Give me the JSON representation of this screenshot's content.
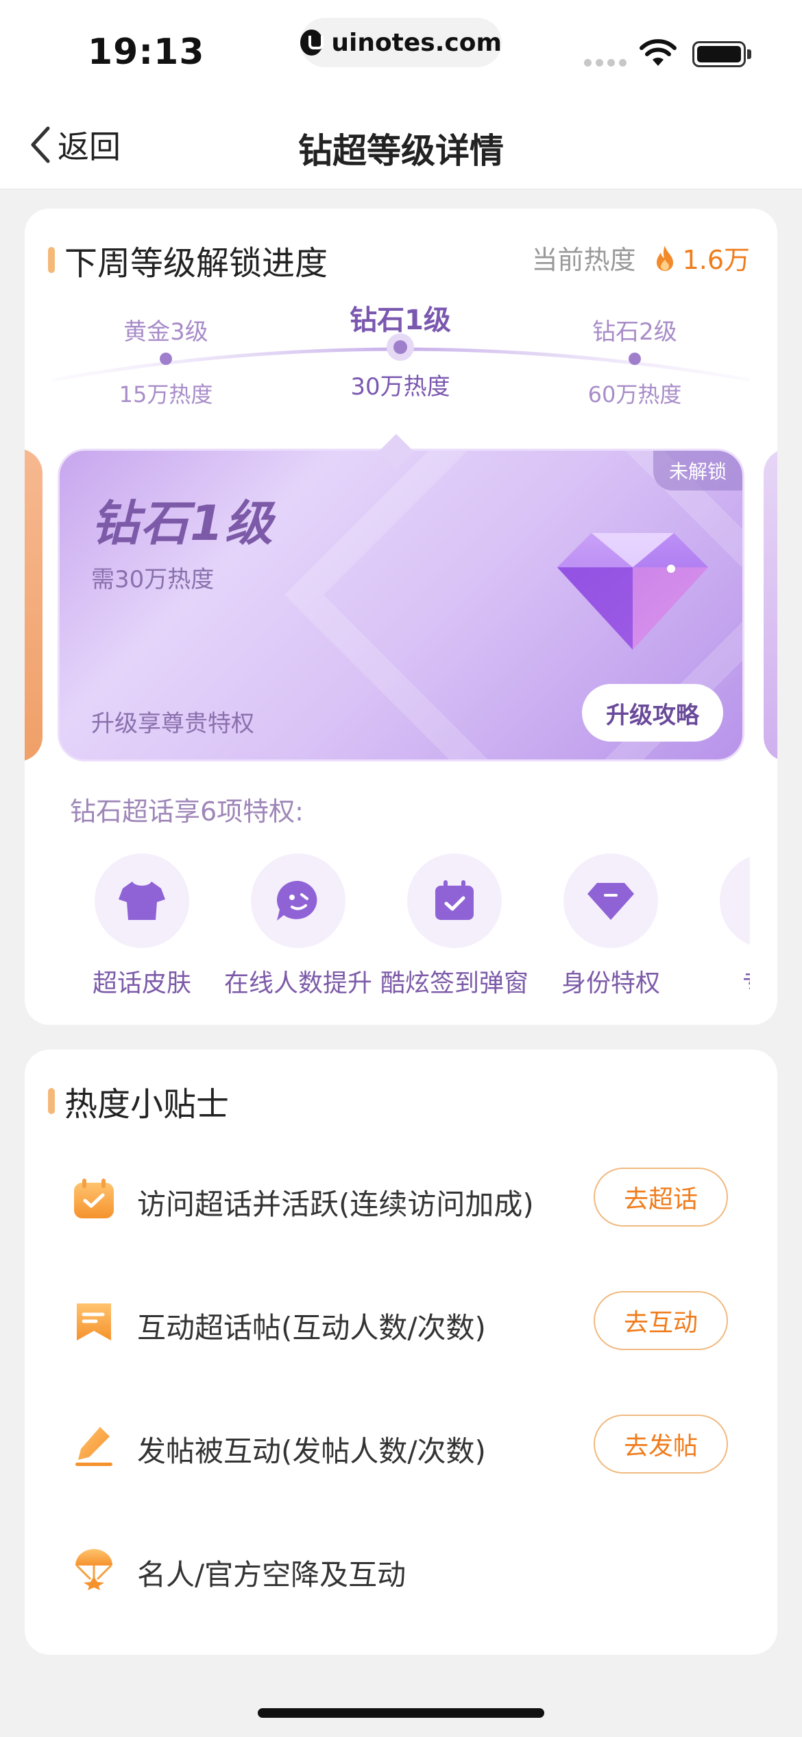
{
  "status_bar": {
    "time": "19:13",
    "url": "uinotes.com",
    "icons": [
      "signal-icon",
      "wifi-icon",
      "battery-icon"
    ]
  },
  "nav": {
    "back_label": "返回",
    "title": "钻超等级详情"
  },
  "unlock_section": {
    "title": "下周等级解锁进度",
    "current_heat_label": "当前热度",
    "current_heat_value": "1.6万",
    "levels": [
      {
        "name": "黄金3级",
        "heat": "15万热度",
        "active": false
      },
      {
        "name": "钻石1级",
        "heat": "30万热度",
        "active": true
      },
      {
        "name": "钻石2级",
        "heat": "60万热度",
        "active": false
      }
    ],
    "tier_card": {
      "badge": "未解锁",
      "name": "钻石1级",
      "requirement": "需30万热度",
      "perk_text": "升级享尊贵特权",
      "button_label": "升级攻略"
    },
    "privileges_title": "钻石超话享6项特权:",
    "privileges": [
      {
        "label": "超话皮肤",
        "icon": "tshirt-icon"
      },
      {
        "label": "在线人数提升",
        "icon": "chat-face-icon"
      },
      {
        "label": "酷炫签到弹窗",
        "icon": "calendar-check-icon"
      },
      {
        "label": "身份特权",
        "icon": "gem-icon"
      },
      {
        "label": "专属",
        "icon": "badge-icon"
      }
    ]
  },
  "tips_section": {
    "title": "热度小贴士",
    "tips": [
      {
        "text": "访问超话并活跃(连续访问加成)",
        "button": "去超话",
        "icon": "calendar-check-icon"
      },
      {
        "text": "互动超话帖(互动人数/次数)",
        "button": "去互动",
        "icon": "bookmark-icon"
      },
      {
        "text": "发帖被互动(发帖人数/次数)",
        "button": "去发帖",
        "icon": "pencil-icon"
      },
      {
        "text": "名人/官方空降及互动",
        "button": "",
        "icon": "parachute-icon"
      }
    ]
  },
  "colors": {
    "accent_orange": "#f07c1c",
    "accent_purple": "#7c5aa8",
    "background": "#f1f1f1"
  }
}
